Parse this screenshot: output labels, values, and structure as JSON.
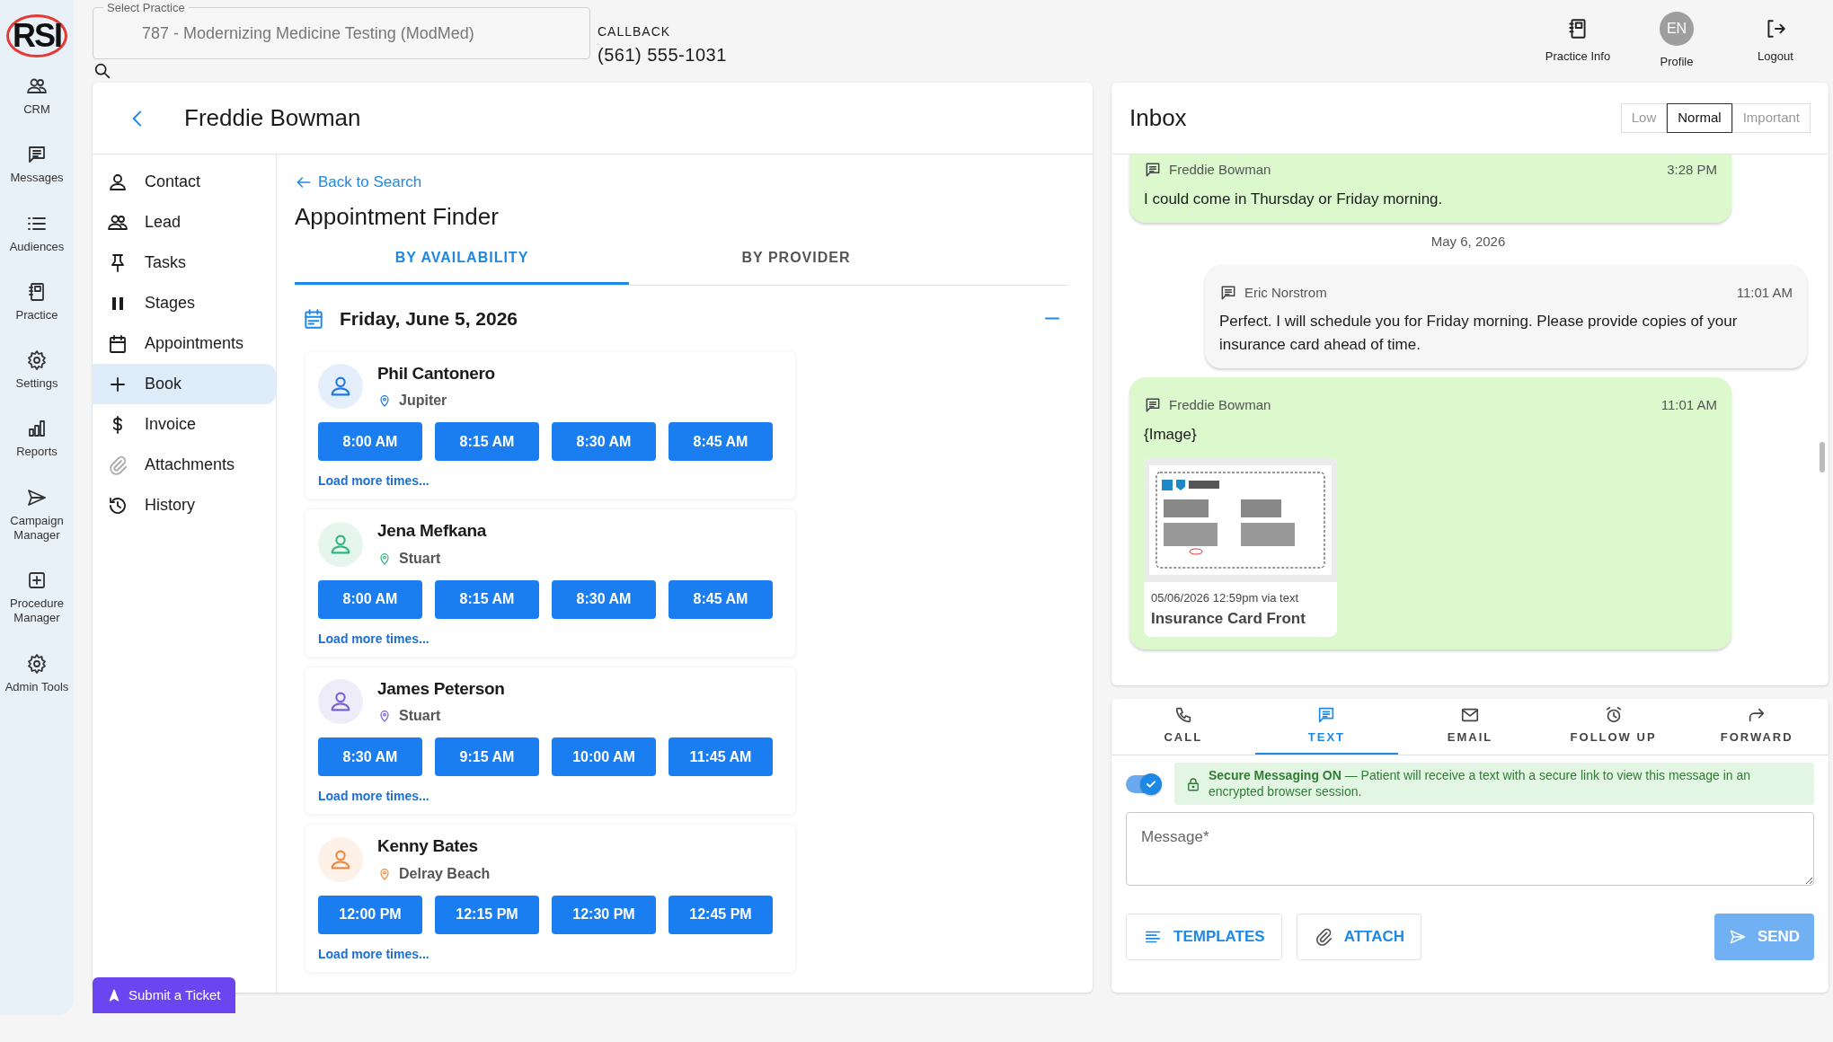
{
  "logo": {
    "text": "RSI"
  },
  "rail": {
    "items": [
      {
        "label": "CRM"
      },
      {
        "label": "Messages"
      },
      {
        "label": "Audiences"
      },
      {
        "label": "Practice"
      },
      {
        "label": "Settings"
      },
      {
        "label": "Reports"
      },
      {
        "label": "Campaign Manager"
      },
      {
        "label": "Procedure Manager"
      },
      {
        "label": "Admin Tools"
      }
    ]
  },
  "topbar": {
    "practice_select": {
      "label": "Select Practice",
      "value": "787 - Modernizing Medicine Testing (ModMed)"
    },
    "callback": {
      "label": "CALLBACK",
      "phone": "(561) 555-1031"
    },
    "actions": [
      {
        "label": "Practice Info"
      },
      {
        "label": "Profile",
        "avatar": "EN"
      },
      {
        "label": "Logout"
      }
    ]
  },
  "patient": {
    "name": "Freddie Bowman"
  },
  "patient_nav": [
    {
      "label": "Contact",
      "selected": false
    },
    {
      "label": "Lead",
      "selected": false
    },
    {
      "label": "Tasks",
      "selected": false
    },
    {
      "label": "Stages",
      "selected": false
    },
    {
      "label": "Appointments",
      "selected": false
    },
    {
      "label": "Book",
      "selected": true
    },
    {
      "label": "Invoice",
      "selected": false
    },
    {
      "label": "Attachments",
      "selected": false
    },
    {
      "label": "History",
      "selected": false
    }
  ],
  "appointment_finder": {
    "back_link": "Back to Search",
    "title": "Appointment Finder",
    "tabs": [
      {
        "label": "BY AVAILABILITY",
        "selected": true
      },
      {
        "label": "BY PROVIDER",
        "selected": false
      }
    ],
    "date": "Friday, June 5, 2026",
    "providers": [
      {
        "name": "Phil Cantonero",
        "location": "Jupiter",
        "color": "#1f78e0",
        "times": [
          "8:00 AM",
          "8:15 AM",
          "8:30 AM",
          "8:45 AM"
        ],
        "more": "Load more times..."
      },
      {
        "name": "Jena Mefkana",
        "location": "Stuart",
        "color": "#2fb67c",
        "times": [
          "8:00 AM",
          "8:15 AM",
          "8:30 AM",
          "8:45 AM"
        ],
        "more": "Load more times..."
      },
      {
        "name": "James Peterson",
        "location": "Stuart",
        "color": "#7b5fd6",
        "times": [
          "8:30 AM",
          "9:15 AM",
          "10:00 AM",
          "11:45 AM"
        ],
        "more": "Load more times..."
      },
      {
        "name": "Kenny Bates",
        "location": "Delray Beach",
        "color": "#ef8a3e",
        "times": [
          "12:00 PM",
          "12:15 PM",
          "12:30 PM",
          "12:45 PM"
        ],
        "more": "Load more times..."
      }
    ]
  },
  "submit_ticket": {
    "label": "Submit a Ticket"
  },
  "inbox": {
    "title": "Inbox",
    "priorities": [
      {
        "label": "Low",
        "selected": false
      },
      {
        "label": "Normal",
        "selected": true
      },
      {
        "label": "Important",
        "selected": false
      }
    ],
    "messages": [
      {
        "kind": "incoming",
        "sender": "Freddie Bowman",
        "time": "3:28 PM",
        "text": "I could come in Thursday or Friday morning."
      },
      {
        "kind": "date",
        "text": "May 6, 2026"
      },
      {
        "kind": "outgoing",
        "sender": "Eric Norstrom",
        "time": "11:01 AM",
        "text": "Perfect. I will schedule you for Friday morning. Please provide copies of your insurance card ahead of time."
      },
      {
        "kind": "incoming",
        "sender": "Freddie Bowman",
        "time": "11:01 AM",
        "text": "{Image}",
        "attachment": {
          "kind": "picture",
          "caption": "05/06/2026 12:59pm via text",
          "title": "Insurance Card Front"
        }
      }
    ]
  },
  "compose": {
    "tabs": [
      {
        "label": "CALL",
        "selected": false
      },
      {
        "label": "TEXT",
        "selected": true
      },
      {
        "label": "EMAIL",
        "selected": false
      },
      {
        "label": "FOLLOW UP",
        "selected": false
      },
      {
        "label": "FORWARD",
        "selected": false
      }
    ],
    "secure_messaging": {
      "on": true,
      "notice": "**Secure Messaging ON** — Patient will receive a text with a secure link to view this message in an encrypted browser session."
    },
    "message": {
      "placeholder": "Message*"
    },
    "buttons": [
      {
        "label": "TEMPLATES"
      },
      {
        "label": "ATTACH"
      }
    ],
    "send": {
      "label": "SEND",
      "disabled": true
    }
  }
}
